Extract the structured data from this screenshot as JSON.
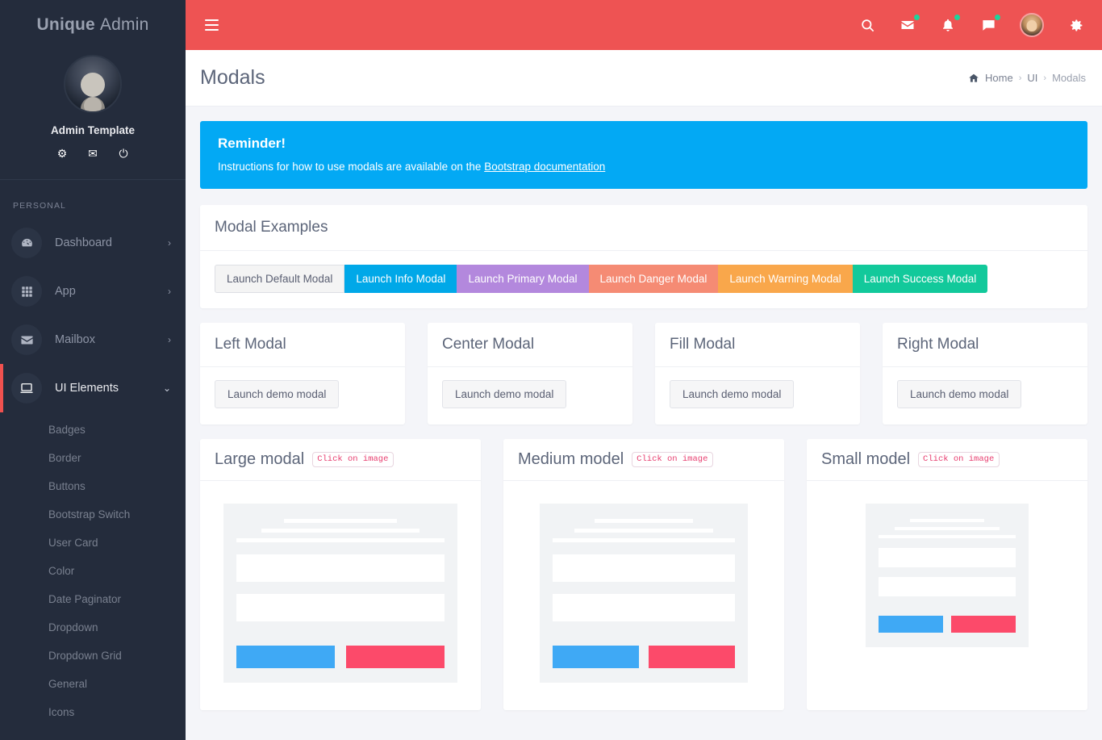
{
  "brand": {
    "bold": "Unique",
    "light": "Admin"
  },
  "profile": {
    "name": "Admin Template",
    "icons": [
      {
        "name": "settings-icon",
        "glyph": "⚙"
      },
      {
        "name": "mail-icon",
        "glyph": "✉"
      },
      {
        "name": "power-icon",
        "glyph": "⏻"
      }
    ]
  },
  "sidebar": {
    "section_label": "PERSONAL",
    "items": [
      {
        "label": "Dashboard",
        "icon": "dashboard-icon",
        "caret": "›",
        "active": false
      },
      {
        "label": "App",
        "icon": "grid-icon",
        "caret": "›",
        "active": false
      },
      {
        "label": "Mailbox",
        "icon": "envelope-icon",
        "caret": "›",
        "active": false
      },
      {
        "label": "UI Elements",
        "icon": "monitor-icon",
        "caret": "⌄",
        "active": true
      }
    ],
    "subitems": [
      {
        "label": "Badges"
      },
      {
        "label": "Border"
      },
      {
        "label": "Buttons"
      },
      {
        "label": "Bootstrap Switch"
      },
      {
        "label": "User Card"
      },
      {
        "label": "Color"
      },
      {
        "label": "Date Paginator"
      },
      {
        "label": "Dropdown"
      },
      {
        "label": "Dropdown Grid"
      },
      {
        "label": "General"
      },
      {
        "label": "Icons"
      }
    ]
  },
  "topbar": {
    "icons": [
      {
        "name": "search-icon",
        "dot": false
      },
      {
        "name": "mail-icon",
        "dot": true
      },
      {
        "name": "bell-icon",
        "dot": true
      },
      {
        "name": "chat-icon",
        "dot": true
      }
    ],
    "gear_name": "settings-gear-icon"
  },
  "page": {
    "title": "Modals",
    "breadcrumb": {
      "home": "Home",
      "section": "UI",
      "current": "Modals",
      "separator": "›"
    }
  },
  "alert": {
    "heading": "Reminder!",
    "text_before": "Instructions for how to use modals are available on the ",
    "link": "Bootstrap documentation"
  },
  "modal_examples": {
    "title": "Modal Examples",
    "buttons": [
      {
        "label": "Launch Default Modal",
        "variant": "default",
        "color": "#f4f4f4"
      },
      {
        "label": "Launch Info Modal",
        "variant": "info",
        "color": "#00a8e8"
      },
      {
        "label": "Launch Primary Modal",
        "variant": "primary",
        "color": "#b388dd"
      },
      {
        "label": "Launch Danger Modal",
        "variant": "danger",
        "color": "#f58b74"
      },
      {
        "label": "Launch Warning Modal",
        "variant": "warning",
        "color": "#f9a74b"
      },
      {
        "label": "Launch Success Modal",
        "variant": "success",
        "color": "#12c99b"
      }
    ]
  },
  "position_cards": [
    {
      "title": "Left Modal",
      "button": "Launch demo modal"
    },
    {
      "title": "Center Modal",
      "button": "Launch demo modal"
    },
    {
      "title": "Fill Modal",
      "button": "Launch demo modal"
    },
    {
      "title": "Right Modal",
      "button": "Launch demo modal"
    }
  ],
  "size_cards": [
    {
      "title": "Large modal",
      "badge": "Click on image",
      "size": "lg"
    },
    {
      "title": "Medium model",
      "badge": "Click on image",
      "size": "md"
    },
    {
      "title": "Small model",
      "badge": "Click on image",
      "size": "sm"
    }
  ],
  "colors": {
    "header": "#ee5353",
    "sidebar": "#242c3c",
    "alert": "#03a9f4",
    "accent_blue": "#3fa9f5",
    "accent_pink": "#fc4a6a",
    "badge_text": "#e83e70"
  }
}
